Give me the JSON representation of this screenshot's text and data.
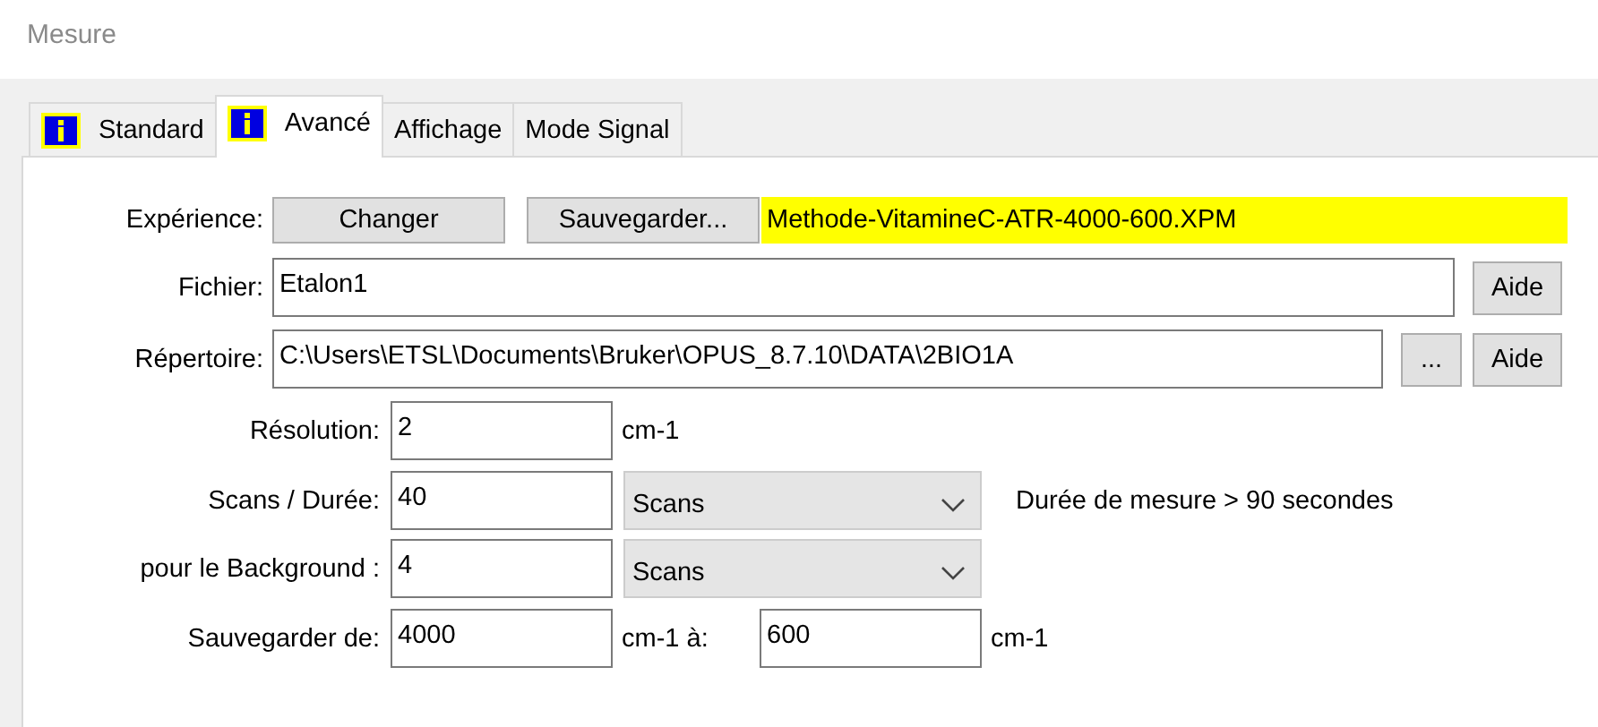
{
  "window": {
    "title": "Mesure"
  },
  "tabs": [
    {
      "label": "Standard",
      "icon": true,
      "selected": false
    },
    {
      "label": "Avancé",
      "icon": true,
      "selected": true
    },
    {
      "label": "Affichage",
      "icon": false,
      "selected": false
    },
    {
      "label": "Mode Signal",
      "icon": false,
      "selected": false
    }
  ],
  "experience": {
    "label": "Expérience:",
    "buttons": [
      "Changer",
      "Sauvegarder..."
    ],
    "value": "Methode-VitamineC-ATR-4000-600.XPM"
  },
  "file": {
    "label": "Fichier:",
    "value": "Etalon1",
    "help": "Aide"
  },
  "directory": {
    "label": "Répertoire:",
    "value": "C:\\Users\\ETSL\\Documents\\Bruker\\OPUS_8.7.10\\DATA\\2BIO1A",
    "browse": "...",
    "help": "Aide"
  },
  "resolution": {
    "label": "Résolution:",
    "value": "2",
    "unit": "cm-1"
  },
  "scans": {
    "label": "Scans / Durée:",
    "value": "40",
    "mode": "Scans",
    "note": "Durée de mesure > 90 secondes"
  },
  "background": {
    "label": "pour le Background :",
    "value": "4",
    "mode": "Scans"
  },
  "save_range": {
    "label": "Sauvegarder de:",
    "from": "4000",
    "from_unit": "cm-1 à:",
    "to": "600",
    "to_unit": "cm-1"
  }
}
